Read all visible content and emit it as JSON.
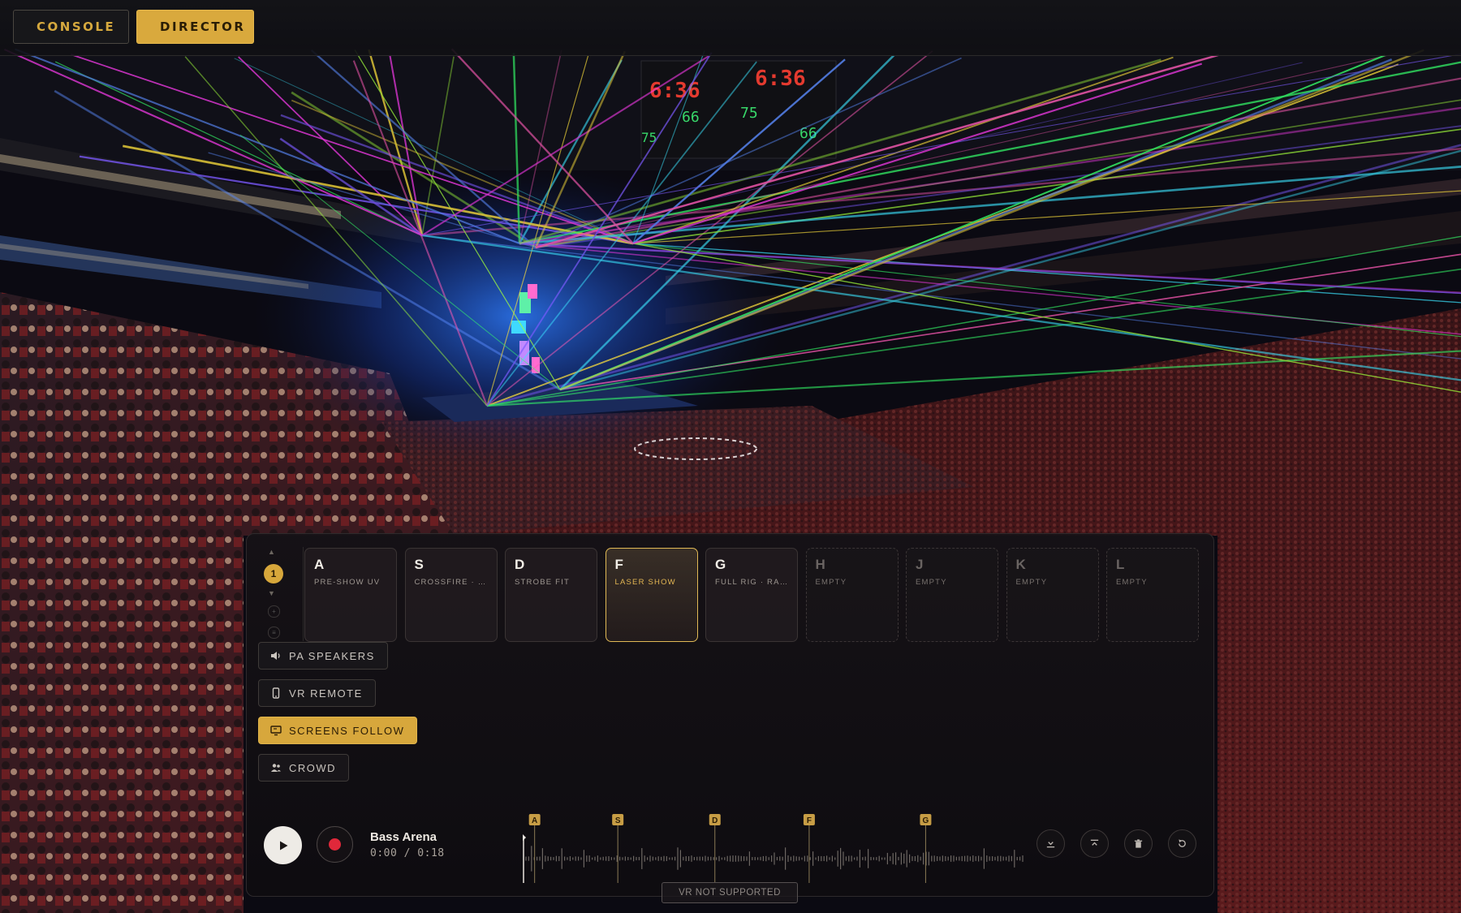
{
  "colors": {
    "accent": "#d9a93d",
    "record": "#e0283a",
    "panel_bg": "#161216",
    "scoreboard_red": "#e43a2f",
    "scoreboard_green": "#38d86a"
  },
  "topbar": {
    "console_label": "CONSOLE",
    "console_icon": "grid-icon",
    "director_label": "DIRECTOR",
    "director_icon": "record-dot-icon",
    "active_tab": "DIRECTOR"
  },
  "scene": {
    "scoreboard_time_left": "6:36",
    "scoreboard_time_right": "6:36",
    "score_a": "75",
    "score_b": "66",
    "score_c": "75",
    "score_d": "66"
  },
  "director": {
    "bank_number": "1",
    "pads": [
      {
        "key": "A",
        "name": "PRE-SHOW UV",
        "state": "loaded"
      },
      {
        "key": "S",
        "name": "CROSSFIRE · F...",
        "state": "loaded"
      },
      {
        "key": "D",
        "name": "STROBE FIT",
        "state": "loaded"
      },
      {
        "key": "F",
        "name": "LASER SHOW",
        "state": "active"
      },
      {
        "key": "G",
        "name": "FULL RIG · RAI...",
        "state": "loaded"
      },
      {
        "key": "H",
        "name": "EMPTY",
        "state": "empty"
      },
      {
        "key": "J",
        "name": "EMPTY",
        "state": "empty"
      },
      {
        "key": "K",
        "name": "EMPTY",
        "state": "empty"
      },
      {
        "key": "L",
        "name": "EMPTY",
        "state": "empty"
      }
    ],
    "outputs": [
      {
        "label": "PA SPEAKERS",
        "icon": "speaker-icon",
        "on": false
      },
      {
        "label": "VR REMOTE",
        "icon": "phone-icon",
        "on": false
      },
      {
        "label": "SCREENS FOLLOW",
        "icon": "monitor-icon",
        "on": true
      },
      {
        "label": "CROWD",
        "icon": "people-icon",
        "on": false
      }
    ]
  },
  "transport": {
    "track_title": "Bass Arena",
    "time": "0:00 / 0:18",
    "progress": 0,
    "cue_markers": [
      "A",
      "S",
      "D",
      "F",
      "G"
    ],
    "cue_positions_sec": [
      0.4,
      3.4,
      6.9,
      10.3,
      14.5
    ],
    "duration_sec": 18
  },
  "tools": [
    "download-icon",
    "upload-icon",
    "trash-icon",
    "reset-icon"
  ],
  "vr_status": "VR NOT SUPPORTED"
}
